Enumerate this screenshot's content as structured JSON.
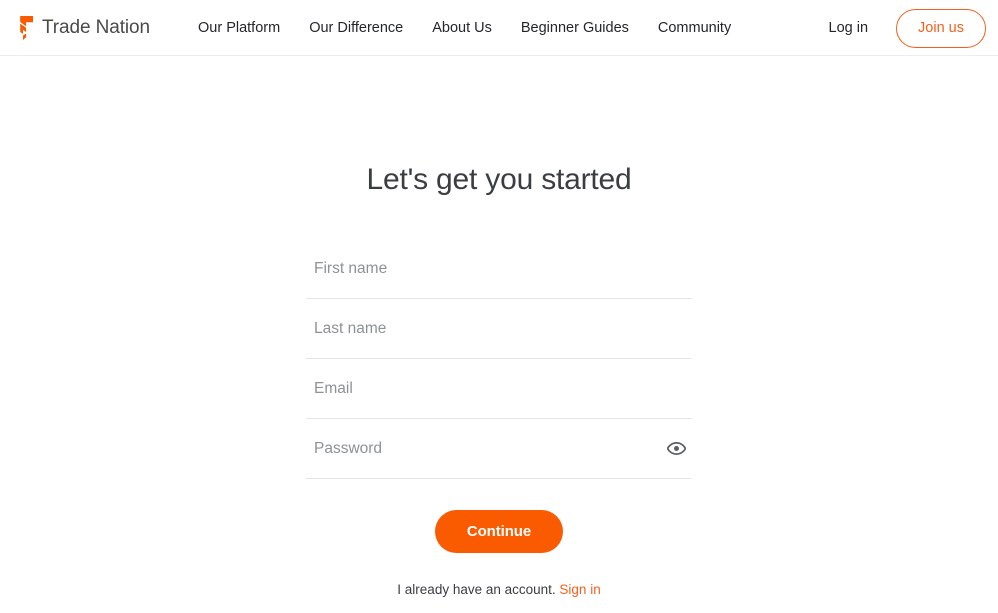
{
  "header": {
    "brand": {
      "name": "Trade Nation",
      "mark_color": "#fa5a00"
    },
    "nav": [
      {
        "label": "Our Platform"
      },
      {
        "label": "Our Difference"
      },
      {
        "label": "About Us"
      },
      {
        "label": "Beginner Guides"
      },
      {
        "label": "Community"
      }
    ],
    "login_label": "Log in",
    "join_label": "Join us"
  },
  "main": {
    "title": "Let's get you started",
    "fields": [
      {
        "name": "first-name",
        "placeholder": "First name",
        "value": "",
        "type": "text"
      },
      {
        "name": "last-name",
        "placeholder": "Last name",
        "value": "",
        "type": "text"
      },
      {
        "name": "email",
        "placeholder": "Email",
        "value": "",
        "type": "email"
      },
      {
        "name": "password",
        "placeholder": "Password",
        "value": "",
        "type": "password"
      }
    ],
    "password_toggle_icon": "eye-icon",
    "continue_label": "Continue",
    "account_note": "I already have an account.",
    "signin_label": "Sign in"
  },
  "colors": {
    "brand_orange": "#fa5a00",
    "link_orange": "#f2611d",
    "text_dark": "#3a3d42",
    "placeholder_grey": "#8d9299",
    "field_border": "#e4e6e8",
    "header_border": "#eceded"
  }
}
